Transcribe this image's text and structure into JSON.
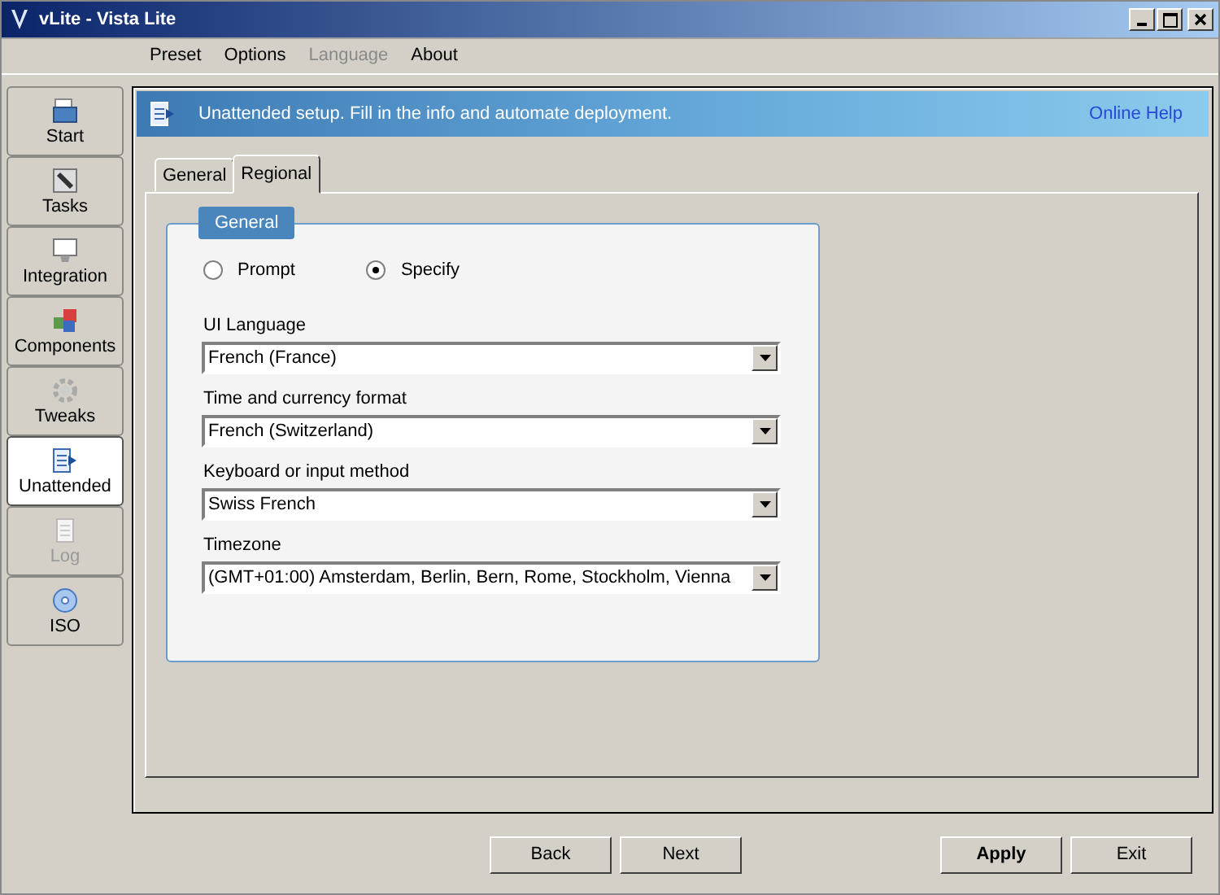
{
  "window": {
    "title": "vLite - Vista Lite"
  },
  "menu": [
    {
      "label": "Preset",
      "disabled": false
    },
    {
      "label": "Options",
      "disabled": false
    },
    {
      "label": "Language",
      "disabled": true
    },
    {
      "label": "About",
      "disabled": false
    }
  ],
  "sidebar": {
    "items": [
      {
        "label": "Start",
        "selected": false,
        "disabled": false
      },
      {
        "label": "Tasks",
        "selected": false,
        "disabled": false
      },
      {
        "label": "Integration",
        "selected": false,
        "disabled": false
      },
      {
        "label": "Components",
        "selected": false,
        "disabled": false
      },
      {
        "label": "Tweaks",
        "selected": false,
        "disabled": false
      },
      {
        "label": "Unattended",
        "selected": true,
        "disabled": false
      },
      {
        "label": "Log",
        "selected": false,
        "disabled": true
      },
      {
        "label": "ISO",
        "selected": false,
        "disabled": false
      }
    ]
  },
  "banner": {
    "text": "Unattended setup. Fill in the info and automate deployment.",
    "link": "Online Help"
  },
  "tabs": [
    {
      "label": "General",
      "selected": false
    },
    {
      "label": "Regional",
      "selected": true
    }
  ],
  "group": {
    "title": "General",
    "options": [
      {
        "label": "Prompt",
        "selected": false
      },
      {
        "label": "Specify",
        "selected": true
      }
    ],
    "fields": [
      {
        "label": "UI Language",
        "value": "French (France)"
      },
      {
        "label": "Time and currency format",
        "value": "French (Switzerland)"
      },
      {
        "label": "Keyboard or input method",
        "value": "Swiss French"
      },
      {
        "label": "Timezone",
        "value": "(GMT+01:00) Amsterdam, Berlin, Bern, Rome, Stockholm, Vienna"
      }
    ]
  },
  "buttons": [
    {
      "label": "Back",
      "default": false
    },
    {
      "label": "Next",
      "default": false
    },
    {
      "label": "Apply",
      "default": true
    },
    {
      "label": "Exit",
      "default": false
    }
  ]
}
